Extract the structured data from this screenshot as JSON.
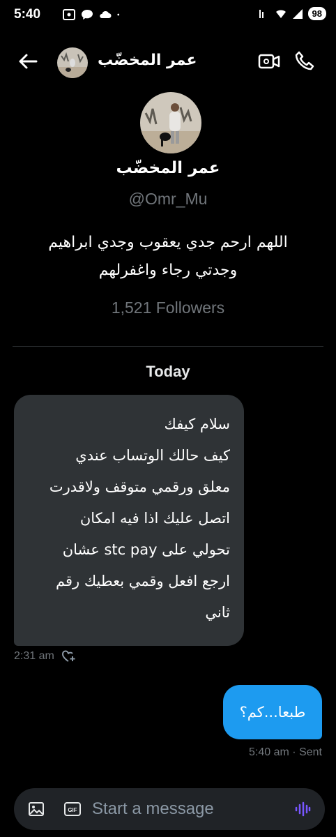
{
  "status_bar": {
    "time": "5:40",
    "battery": "98"
  },
  "header": {
    "name": "عمر المخضّب"
  },
  "profile": {
    "name": "عمر المخضّب",
    "handle": "@Omr_Mu",
    "bio": "اللهم ارحم جدي يعقوب وجدي ابراهيم وجدتي رجاء واغفرلهم",
    "followers": "1,521 Followers"
  },
  "conversation": {
    "date_divider": "Today",
    "messages": [
      {
        "direction": "received",
        "text": "سلام كيفك\nكيف حالك الوتساب عندي\nمعلق ورقمي متوقف ولاقدرت\nاتصل عليك اذا فيه امكان\nتحولي على stc pay عشان\nارجع افعل وقمي بعطيك رقم\nثاني",
        "time": "2:31 am"
      },
      {
        "direction": "sent",
        "text": "طبعا...كم؟",
        "time_status": "5:40 am · Sent"
      }
    ]
  },
  "composer": {
    "placeholder": "Start a message"
  },
  "colors": {
    "background": "#000000",
    "received_bubble": "#2f3336",
    "sent_bubble": "#1d9bf0",
    "muted_text": "#71767b",
    "voice_accent": "#7856ff"
  }
}
